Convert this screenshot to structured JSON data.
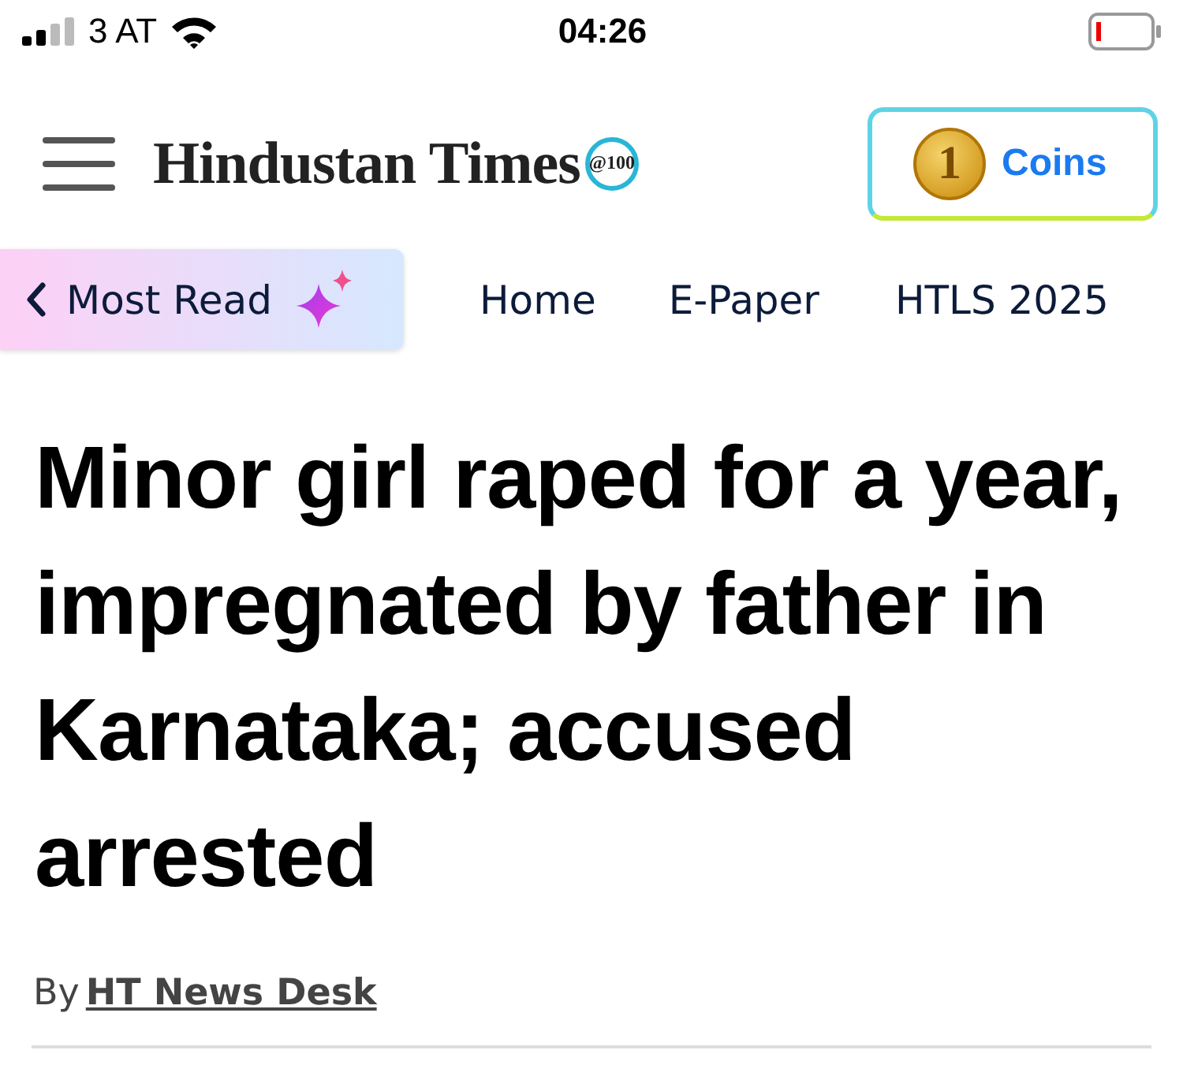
{
  "status_bar": {
    "carrier": "3 AT",
    "time": "04:26"
  },
  "header": {
    "logo": "Hindustan Times",
    "logo_badge": "@100",
    "coins_button": "Coins",
    "coin_digit": "1"
  },
  "nav": {
    "back_button": "Most Read",
    "items": [
      {
        "label": "Home"
      },
      {
        "label": "E-Paper"
      },
      {
        "label": "HTLS 2025"
      }
    ]
  },
  "article": {
    "headline": "Minor girl raped for a year, impregnated by father in Karnataka; accused arrested",
    "byline_prefix": "By",
    "author": "HT News Desk"
  }
}
